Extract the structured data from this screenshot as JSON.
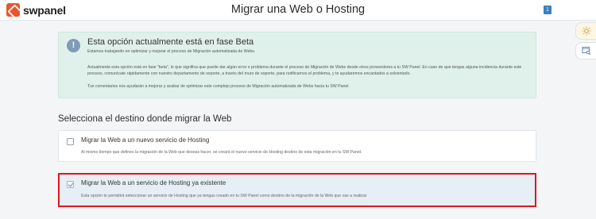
{
  "header": {
    "logo_text": "swpanel",
    "title": "Migrar una Web o Hosting",
    "user_badge": "1"
  },
  "side_tools": [
    {
      "icon": "sun-icon"
    },
    {
      "icon": "search-window-icon"
    }
  ],
  "beta_notice": {
    "icon_glyph": "!",
    "title": "Esta opción actualmente está en fase Beta",
    "paragraph_1": "Estamos trabajando en optimizar y mejorar el proceso de Migración automatizada de Webs.",
    "paragraph_2": "Actualmente esta opción está en fase \"beta\", lo que significa que puede dar algún error o problema durante el proceso de Migración de Webs desde otros proveedores a tu SW Panel. En caso de que tengas alguna incidencia durante este proceso, comunícate rápidamente con nuestro departamento de soporte, a través del muro de soporte, para notificarnos el problema, y te ayudaremos encantados a solventarlo.",
    "paragraph_3": "Tus comentarios nos ayudarán a mejorar y acabar de optimizar este complejo proceso de Migración automatizada de Webs hacia tu SW Panel."
  },
  "destination": {
    "section_title": "Selecciona el destino donde migrar la Web",
    "options": [
      {
        "label": "Migrar la Web a un nuevo servicio de Hosting",
        "description": "Al mismo tiempo que defines la migración de la Web que deseas hacer, se creará el nuevo servicio de Hosting destino de esta migración en tu SW Panel.",
        "checked": false
      },
      {
        "label": "Migrar la Web a un servicio de Hosting ya existente",
        "description": "Esta opción te permitirá seleccionar un servicio de Hosting que ya tengas creado en tu SW Panel como destino de la migración de la Web que vas a realizar",
        "checked": true
      }
    ]
  },
  "colors": {
    "brand": "#e8552b",
    "beta_background": "#dff1ea",
    "selected_background": "#e6eff6",
    "highlight_border": "#e0151b"
  }
}
